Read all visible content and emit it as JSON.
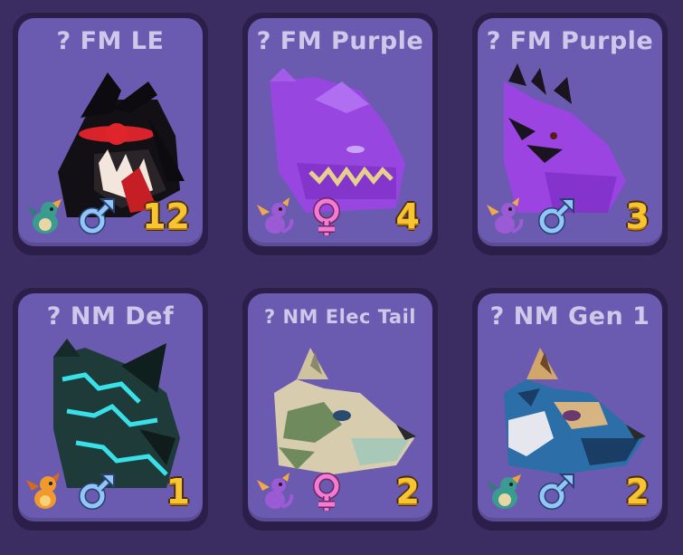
{
  "inventory": {
    "pets": [
      {
        "title": "? FM LE",
        "count": "12",
        "gender": "male",
        "age_icon": "dragon-teal-icon",
        "pet_icon": "black-red-dragon-icon"
      },
      {
        "title": "? FM Purple",
        "count": "4",
        "gender": "female",
        "age_icon": "dragon-purple-icon",
        "pet_icon": "purple-dragon-icon"
      },
      {
        "title": "? FM Purple",
        "count": "3",
        "gender": "male",
        "age_icon": "dragon-purple-icon",
        "pet_icon": "purple-dragon-icon"
      },
      {
        "title": "? NM Def",
        "count": "1",
        "gender": "male",
        "age_icon": "dragon-orange-icon",
        "pet_icon": "teal-black-dragon-icon"
      },
      {
        "title": "? NM Elec Tail",
        "count": "2",
        "gender": "female",
        "age_icon": "dragon-purple-icon",
        "pet_icon": "cream-green-wolf-icon"
      },
      {
        "title": "? NM Gen 1",
        "count": "2",
        "gender": "male",
        "age_icon": "dragon-teal-icon",
        "pet_icon": "blue-tan-wolf-icon"
      }
    ]
  },
  "colors": {
    "background": "#3b2c61",
    "card_face": "#6a5ab0",
    "title_text": "#cfc8ea",
    "count_text": "#f7c531",
    "male": "#8fc7f7",
    "female": "#f57ad3"
  }
}
